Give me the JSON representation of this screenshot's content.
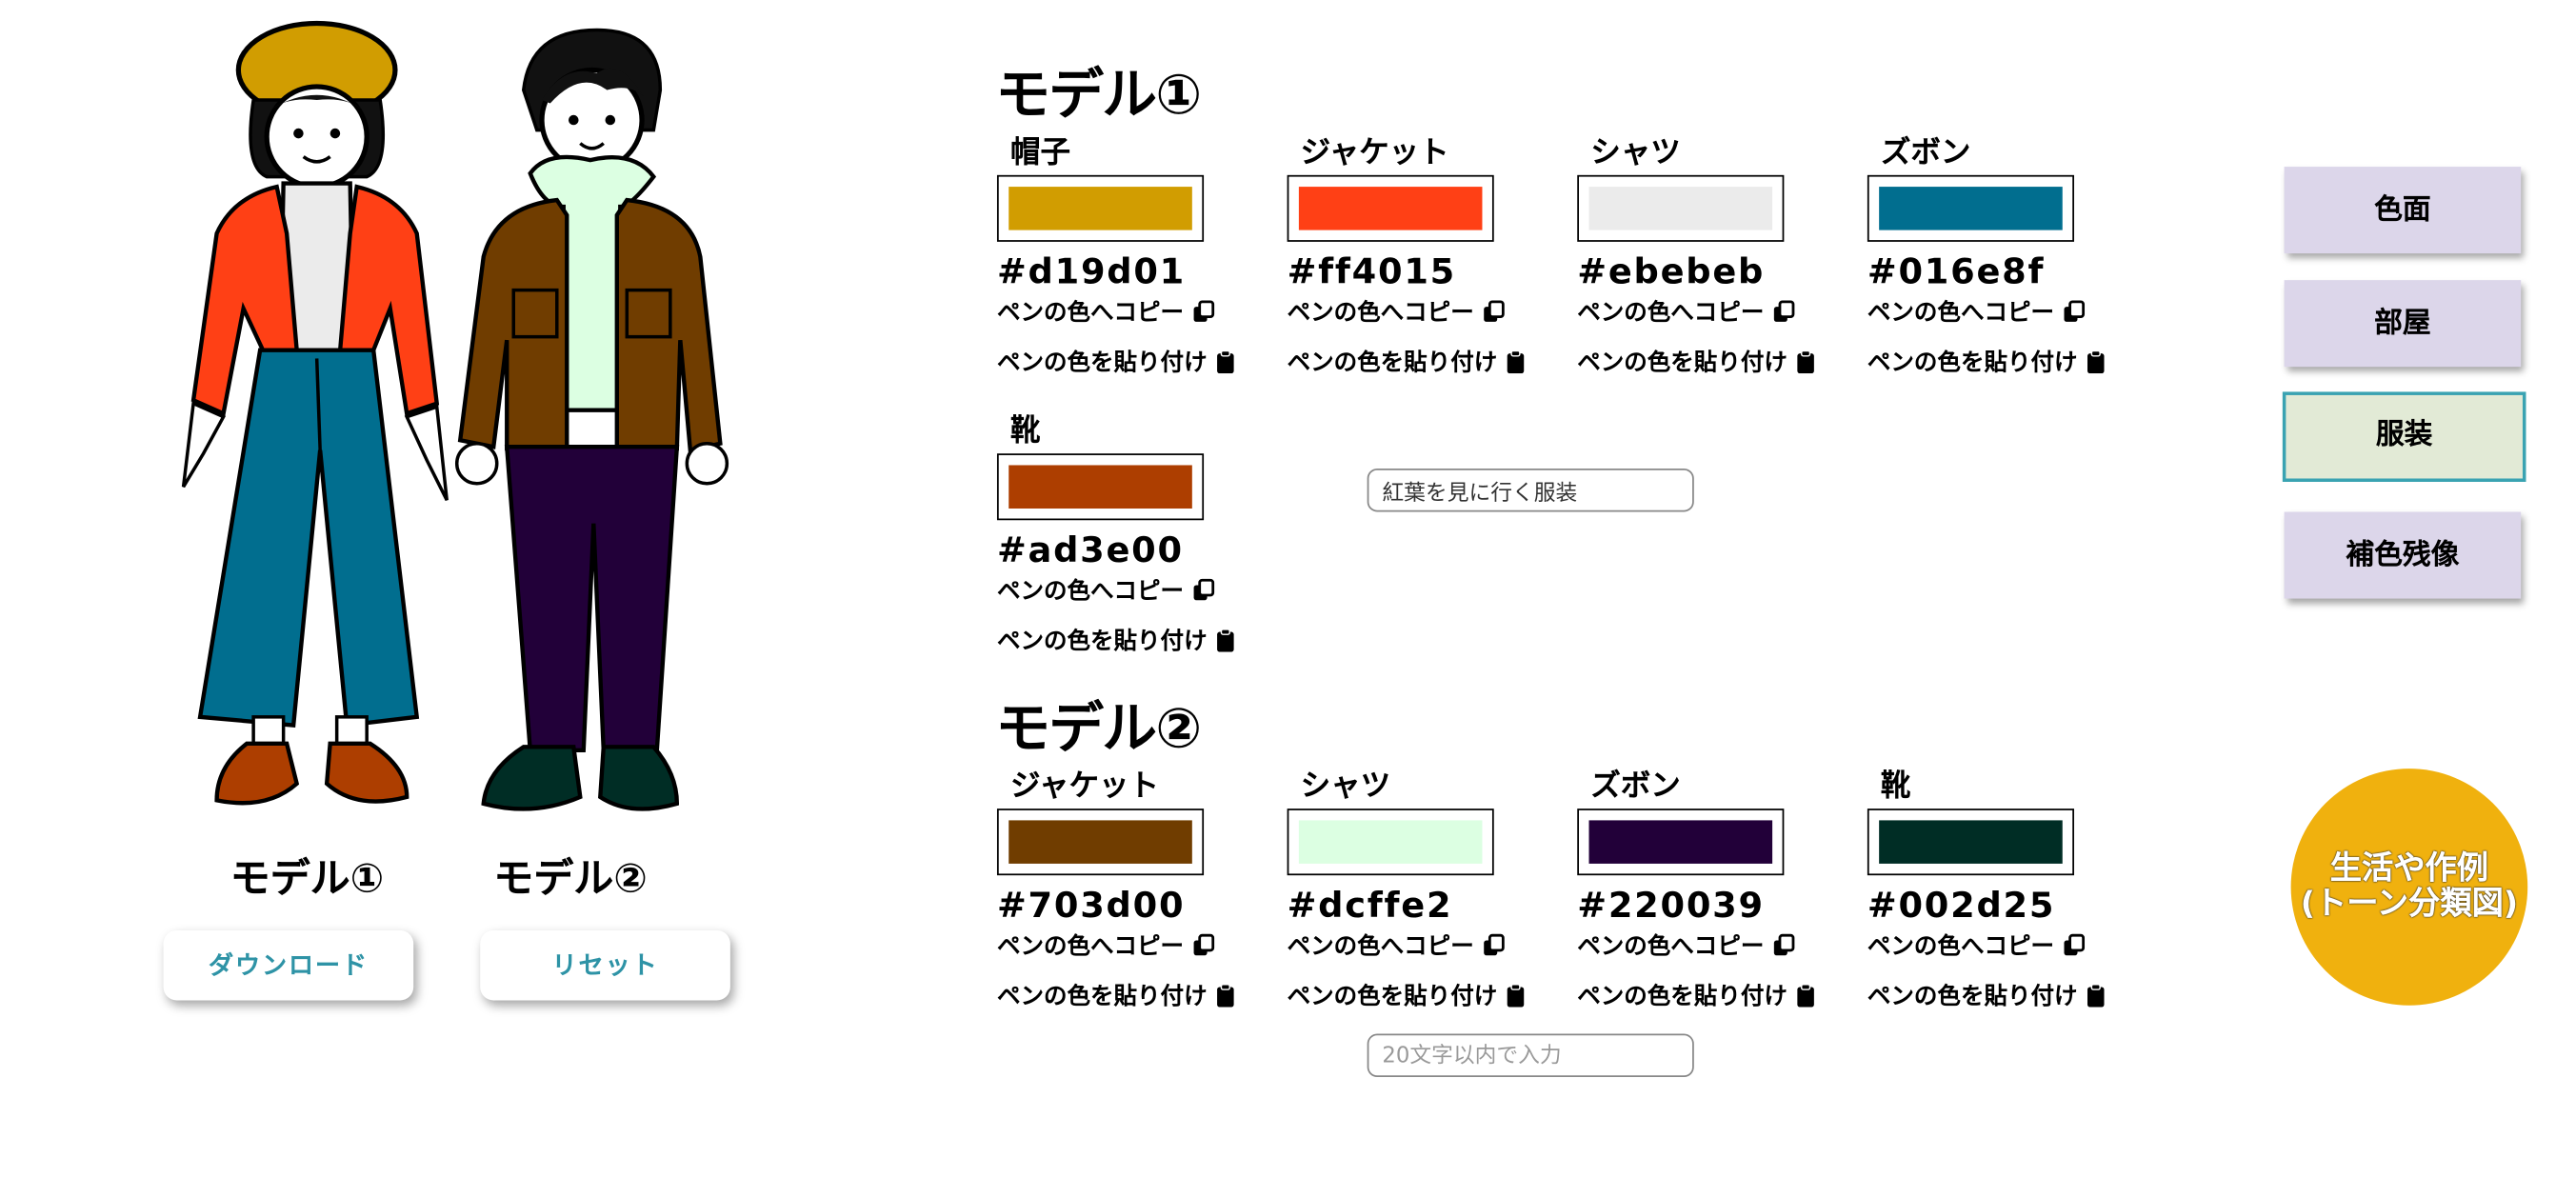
{
  "figures": {
    "model1": {
      "caption": "モデル①",
      "hat": "#d19d01",
      "jacket": "#ff4015",
      "shirt": "#ebebeb",
      "pants": "#016e8f",
      "shoes": "#ad3e00"
    },
    "model2": {
      "caption": "モデル②",
      "jacket": "#703d00",
      "shirt": "#dcffe2",
      "pants": "#220039",
      "shoes": "#002d25"
    }
  },
  "buttons": {
    "download": "ダウンロード",
    "reset": "リセット"
  },
  "model1": {
    "title": "モデル①",
    "items": [
      {
        "label": "帽子",
        "color": "#d19d01",
        "hex": "#d19d01"
      },
      {
        "label": "ジャケット",
        "color": "#ff4015",
        "hex": "#ff4015"
      },
      {
        "label": "シャツ",
        "color": "#ebebeb",
        "hex": "#ebebeb"
      },
      {
        "label": "ズボン",
        "color": "#016e8f",
        "hex": "#016e8f"
      },
      {
        "label": "靴",
        "color": "#ad3e00",
        "hex": "#ad3e00"
      }
    ],
    "title_input_value": "紅葉を見に行く服装"
  },
  "model2": {
    "title": "モデル②",
    "items": [
      {
        "label": "ジャケット",
        "color": "#703d00",
        "hex": "#703d00"
      },
      {
        "label": "シャツ",
        "color": "#dcffe2",
        "hex": "#dcffe2"
      },
      {
        "label": "ズボン",
        "color": "#220039",
        "hex": "#220039"
      },
      {
        "label": "靴",
        "color": "#002d25",
        "hex": "#002d25"
      }
    ],
    "title_input_placeholder": "20文字以内で入力"
  },
  "actions": {
    "copy": "ペンの色へコピー",
    "paste": "ペンの色を貼り付け"
  },
  "menu": {
    "items": [
      "色面",
      "部屋",
      "服装",
      "補色残像"
    ],
    "active": "服装"
  },
  "circle_button": {
    "line1": "生活や作例",
    "line2": "(トーン分類図)"
  }
}
